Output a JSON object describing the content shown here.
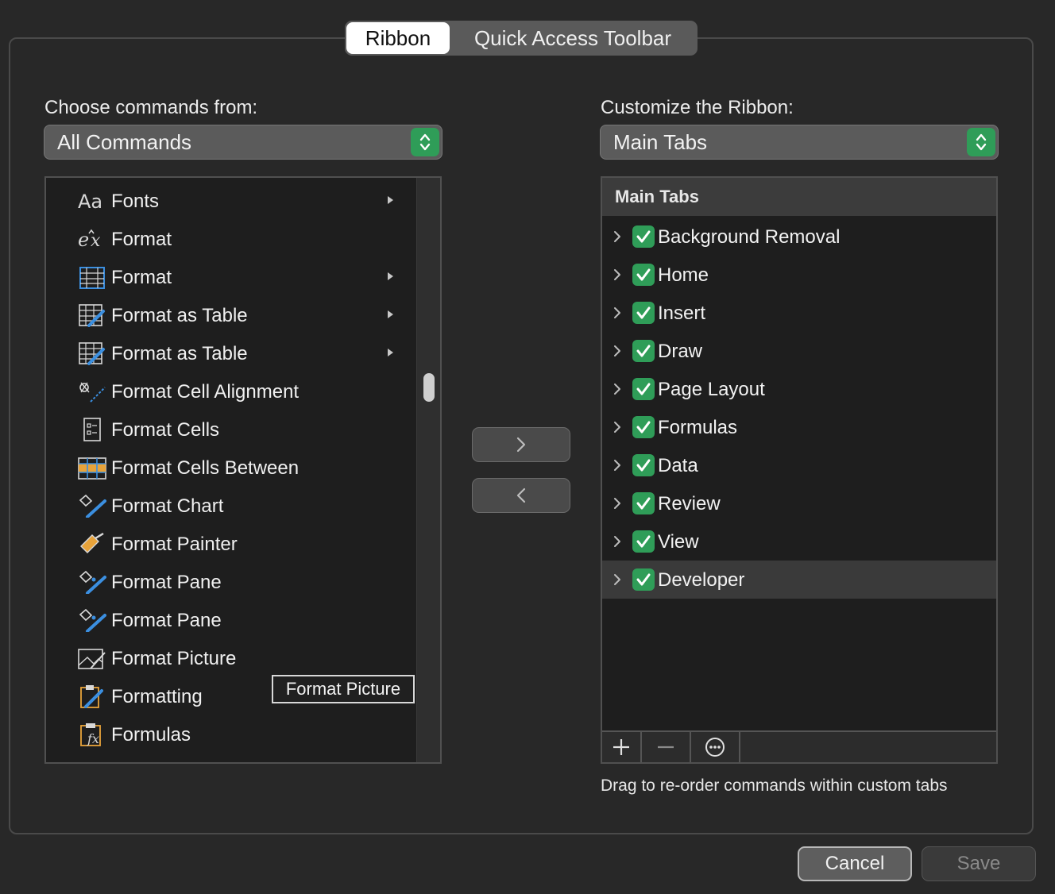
{
  "tabs": [
    {
      "label": "Ribbon",
      "active": true
    },
    {
      "label": "Quick Access Toolbar",
      "active": false
    }
  ],
  "left": {
    "label": "Choose commands from:",
    "popup_value": "All Commands",
    "commands": [
      {
        "label": "Fonts",
        "icon": "font-aa-icon",
        "submenu": true
      },
      {
        "label": "Format",
        "icon": "format-equation-icon",
        "submenu": false
      },
      {
        "label": "Format",
        "icon": "format-grid-icon",
        "submenu": true
      },
      {
        "label": "Format as Table",
        "icon": "format-as-table-icon",
        "submenu": true
      },
      {
        "label": "Format as Table",
        "icon": "format-as-table-icon",
        "submenu": true
      },
      {
        "label": "Format Cell Alignment",
        "icon": "format-cell-alignment-icon",
        "submenu": false
      },
      {
        "label": "Format Cells",
        "icon": "format-cells-icon",
        "submenu": false
      },
      {
        "label": "Format Cells Between",
        "icon": "format-cells-between-icon",
        "submenu": false
      },
      {
        "label": "Format Chart",
        "icon": "format-chart-icon",
        "submenu": false
      },
      {
        "label": "Format Painter",
        "icon": "format-painter-icon",
        "submenu": false
      },
      {
        "label": "Format Pane",
        "icon": "format-pane-icon",
        "submenu": false
      },
      {
        "label": "Format Pane",
        "icon": "format-pane-icon",
        "submenu": false
      },
      {
        "label": "Format Picture",
        "icon": "format-picture-icon",
        "submenu": false
      },
      {
        "label": "Formatting",
        "icon": "formatting-icon",
        "submenu": false
      },
      {
        "label": "Formulas",
        "icon": "formulas-icon",
        "submenu": false
      }
    ],
    "tooltip": "Format Picture"
  },
  "right": {
    "label": "Customize the Ribbon:",
    "popup_value": "Main Tabs",
    "header": "Main Tabs",
    "tabs": [
      {
        "label": "Background Removal",
        "checked": true
      },
      {
        "label": "Home",
        "checked": true
      },
      {
        "label": "Insert",
        "checked": true
      },
      {
        "label": "Draw",
        "checked": true
      },
      {
        "label": "Page Layout",
        "checked": true
      },
      {
        "label": "Formulas",
        "checked": true
      },
      {
        "label": "Data",
        "checked": true
      },
      {
        "label": "Review",
        "checked": true
      },
      {
        "label": "View",
        "checked": true
      },
      {
        "label": "Developer",
        "checked": true,
        "selected": true
      }
    ],
    "hint": "Drag to re-order commands within custom tabs"
  },
  "buttons": {
    "cancel": "Cancel",
    "save": "Save"
  },
  "colors": {
    "accent_green": "#2f9d58",
    "icon_blue": "#3b8fe0",
    "icon_orange": "#e8a33a"
  }
}
